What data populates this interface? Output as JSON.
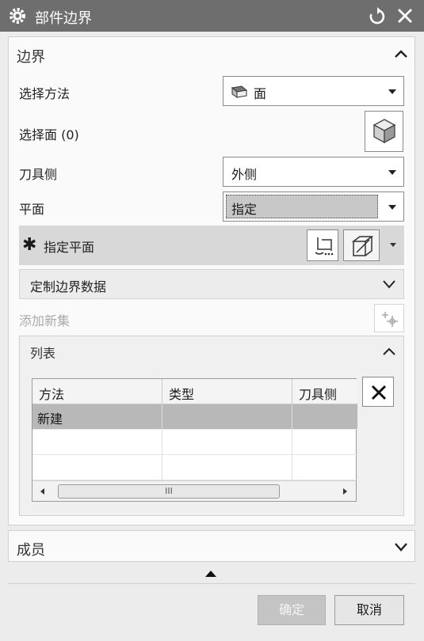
{
  "window": {
    "title": "部件边界"
  },
  "boundary": {
    "section_title": "边界",
    "select_method_label": "选择方法",
    "select_method_value": "面",
    "select_face_label": "选择面 (0)",
    "tool_side_label": "刀具侧",
    "tool_side_value": "外侧",
    "plane_label": "平面",
    "plane_value": "指定",
    "specify_plane_label": "指定平面",
    "custom_boundary_label": "定制边界数据",
    "add_new_set_label": "添加新集"
  },
  "list": {
    "section_title": "列表",
    "columns": [
      "方法",
      "类型",
      "刀具侧"
    ],
    "rows": [
      [
        "新建",
        "",
        ""
      ]
    ],
    "scroll_grip": "III"
  },
  "members": {
    "section_title": "成员"
  },
  "footer": {
    "ok_label": "确定",
    "cancel_label": "取消"
  }
}
